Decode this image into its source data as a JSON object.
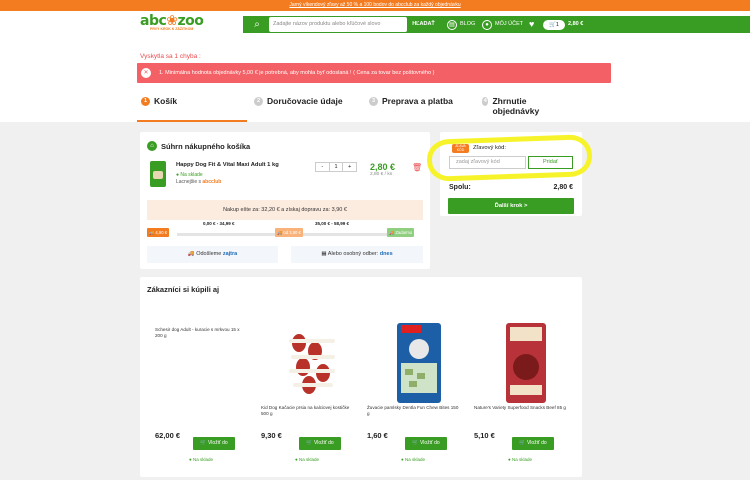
{
  "promo": "Jarný víkendový zľavy až 50 % a 100 bodov do abcclub za každý objednávku",
  "header": {
    "search_placeholder": "Zadajte názov produktu alebo kľúčové slovo",
    "search_button": "HĽADAŤ",
    "blog": "BLOG",
    "account": "MÔJ ÚČET",
    "cart_count": "1",
    "cart_total": "2,80 €",
    "logo_tagline": "PRVÝ KROK K ZÁŽITKOM"
  },
  "error": {
    "heading": "Vyskytla sa 1 chyba :",
    "message": "1. Minimálna hodnota objednávky 5,00 € je potrebná, aby mohla byť odoslaná ! ( Cena za tovar bez poštovného )"
  },
  "steps": [
    {
      "num": "1",
      "label": "Košík"
    },
    {
      "num": "2",
      "label": "Doručovacie údaje"
    },
    {
      "num": "3",
      "label": "Preprava a platba"
    },
    {
      "num": "4",
      "label": "Zhrnutie objednávky"
    }
  ],
  "summary": {
    "title": "Súhrn nákupného košíka",
    "product_name": "Happy Dog Fit & Vital Maxi Adult 1 kg",
    "stock": "Na sklade",
    "cheaper_prefix": "Lacnejšie s",
    "cheaper_brand": "abcclub",
    "qty": "1",
    "minus": "-",
    "plus": "+",
    "price": "2,80 €",
    "unit_price": "2,80 € / ks",
    "freeship": "Nakup ešte za: 32,20 € a získaj dopravu za: 3,90 €",
    "tiers": [
      {
        "range": "0,00 € - 34,99 €",
        "tag": "4,90 €"
      },
      {
        "range": "35,00 € - 58,99 €",
        "tag": "od 3,90 €"
      },
      {
        "range": "",
        "tag": "Zadarmo"
      }
    ],
    "ship_today_prefix": "Odošleme",
    "ship_today": "zajtra",
    "pickup_prefix": "Alebo osobný odber:",
    "pickup": "dnes"
  },
  "checkout": {
    "voucher_tag": "ZĽAVA KÓD",
    "voucher_label": "Zľavový kód:",
    "voucher_placeholder": "zadaj zľavový kód",
    "voucher_button": "Pridať",
    "total_label": "Spolu:",
    "total_value": "2,80 €",
    "continue": "Ďalší krok >"
  },
  "recommended": {
    "title": "Zákazníci si kúpili aj",
    "items": [
      {
        "name": "Schesir dog Adult - kuracie s mrkvou 15 x 200 g",
        "price": "62,00 €",
        "buy": "Vložiť do košíka",
        "stock": "Na sklade"
      },
      {
        "name": "Kid Dog Kačacie prsia na kalciovej kostičke 500 g",
        "price": "9,30 €",
        "buy": "Vložiť do košíka",
        "stock": "Na sklade"
      },
      {
        "name": "Žuvacie pamlsky Dentla Fun Chew Bites 150 g",
        "price": "1,60 €",
        "buy": "Vložiť do košíka",
        "stock": "Na sklade"
      },
      {
        "name": "Nature's Variety Superfood Snacks Beef 85 g",
        "price": "5,10 €",
        "buy": "Vložiť do košíka",
        "stock": "Na sklade"
      }
    ]
  }
}
